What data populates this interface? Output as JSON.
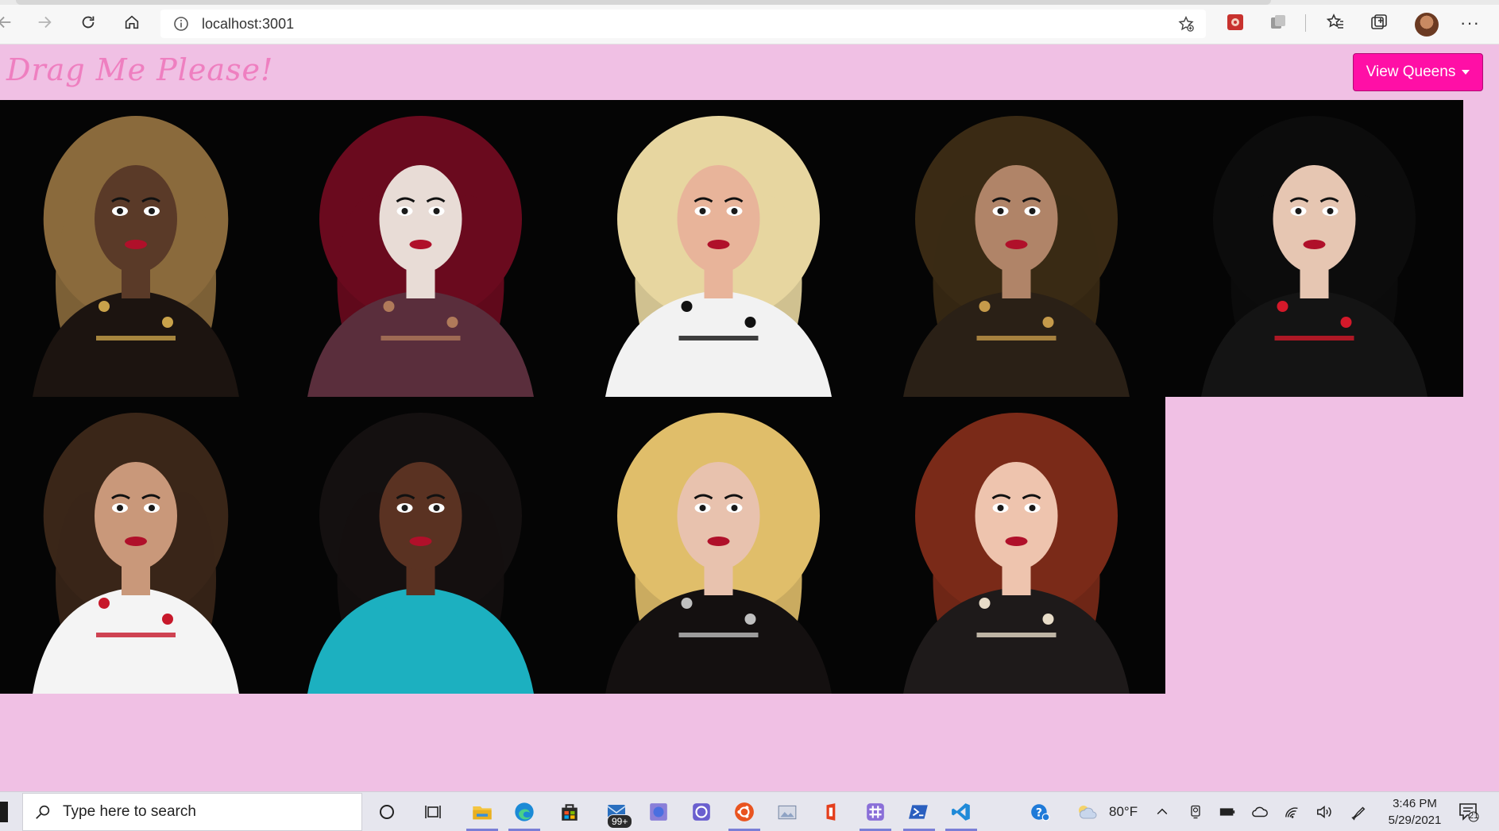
{
  "browser": {
    "url": "localhost:3001",
    "more_label": "···"
  },
  "app": {
    "brand": "Drag Me Please!",
    "view_queens_label": "View Queens"
  },
  "queens": [
    {
      "index": 1,
      "hair_color": "#8a6a3c",
      "outfit_color": "#1c1410",
      "skin_color": "#5a3a28",
      "accent": "#c9a24a"
    },
    {
      "index": 2,
      "hair_color": "#6a0a1e",
      "outfit_color": "#5a2e3c",
      "skin_color": "#e8dcd6",
      "accent": "#b07a5a"
    },
    {
      "index": 3,
      "hair_color": "#e7d6a0",
      "outfit_color": "#f2f2f2",
      "skin_color": "#e8b49a",
      "accent": "#111111"
    },
    {
      "index": 4,
      "hair_color": "#3a2a14",
      "outfit_color": "#2a2016",
      "skin_color": "#b08468",
      "accent": "#c59a4a"
    },
    {
      "index": 5,
      "hair_color": "#0c0c0c",
      "outfit_color": "#141414",
      "skin_color": "#e6c6b2",
      "accent": "#d4192a"
    },
    {
      "index": 6,
      "hair_color": "#3a2618",
      "outfit_color": "#f4f4f4",
      "skin_color": "#c9987a",
      "accent": "#c7182a"
    },
    {
      "index": 7,
      "hair_color": "#141010",
      "outfit_color": "#1cb0c0",
      "skin_color": "#5a3222",
      "accent": "#1cb0c0"
    },
    {
      "index": 8,
      "hair_color": "#e0be6a",
      "outfit_color": "#141010",
      "skin_color": "#e8c2ae",
      "accent": "#c0c0c0"
    },
    {
      "index": 9,
      "hair_color": "#7a2a18",
      "outfit_color": "#1e1a1a",
      "skin_color": "#eec4ae",
      "accent": "#e8dcc8"
    }
  ],
  "taskbar": {
    "search_placeholder": "Type here to search",
    "mail_badge": "99+",
    "weather": "80°F",
    "time": "3:46 PM",
    "date": "5/29/2021",
    "notification_count": "21"
  }
}
